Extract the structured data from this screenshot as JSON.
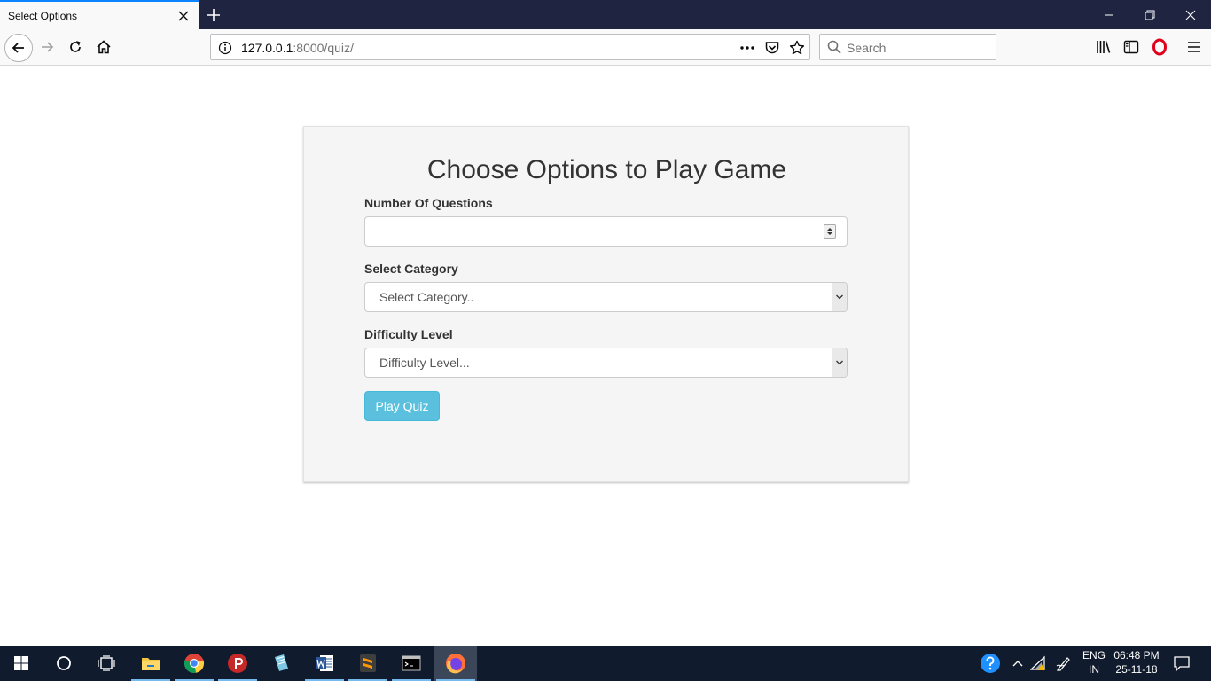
{
  "browser": {
    "tab": {
      "title": "Select Options"
    },
    "url": {
      "host": "127.0.0.1",
      "rest": ":8000/quiz/"
    },
    "search": {
      "placeholder": "Search"
    }
  },
  "page": {
    "title": "Choose Options to Play Game",
    "fields": {
      "questions": {
        "label": "Number Of Questions",
        "value": ""
      },
      "category": {
        "label": "Select Category",
        "selected": "Select Category.."
      },
      "difficulty": {
        "label": "Difficulty Level",
        "selected": "Difficulty Level..."
      }
    },
    "submit_label": "Play Quiz",
    "colors": {
      "button": "#5bc0de",
      "panel": "#f5f5f5",
      "tab_accent": "#0a84ff"
    }
  },
  "taskbar": {
    "apps": [
      "start-icon",
      "cortana-icon",
      "task-view-icon",
      "file-explorer-icon",
      "chrome-icon",
      "psiphon-icon",
      "notepad-icon",
      "word-icon",
      "sublime-icon",
      "terminal-icon",
      "firefox-icon"
    ],
    "lang": "ENG",
    "region": "IN",
    "time": "06:48 PM",
    "date": "25-11-18"
  }
}
